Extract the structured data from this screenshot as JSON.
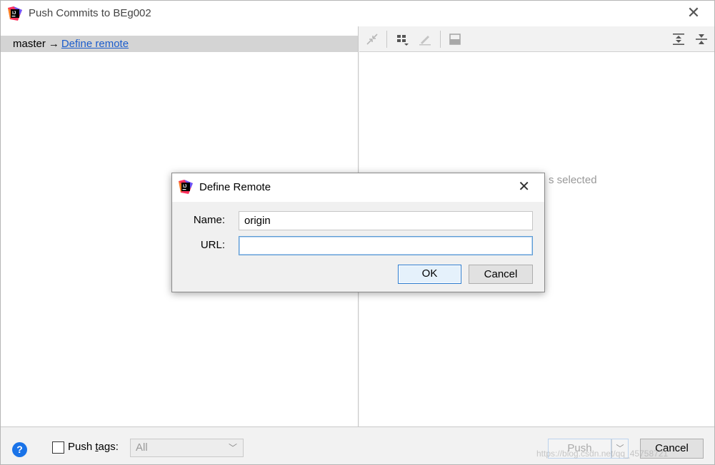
{
  "window": {
    "title": "Push Commits to BEg002"
  },
  "left_pane": {
    "branch": "master",
    "arrow": "→",
    "define_remote_link": "Define remote"
  },
  "right_pane": {
    "empty_text": "s selected"
  },
  "bottom_bar": {
    "help": "?",
    "push_tags_prefix": "Push ",
    "push_tags_underlined": "t",
    "push_tags_suffix": "ags:",
    "tags_select_value": "All",
    "push_label": "Push",
    "cancel_label": "Cancel",
    "watermark": "https://blog.csdn.net/qq_45758721"
  },
  "dialog": {
    "title": "Define Remote",
    "name_label": "Name:",
    "name_value": "origin",
    "url_label": "URL:",
    "url_value": "",
    "ok_label": "OK",
    "cancel_label": "Cancel"
  },
  "colors": {
    "link": "#1a5ccc",
    "accent": "#2c7cd0",
    "help_blue": "#1a73e8"
  },
  "icons": {
    "toolbar": [
      "fetch-icon",
      "group-by-icon",
      "edit-icon",
      "preview-icon",
      "expand-all-icon",
      "collapse-all-icon"
    ]
  }
}
